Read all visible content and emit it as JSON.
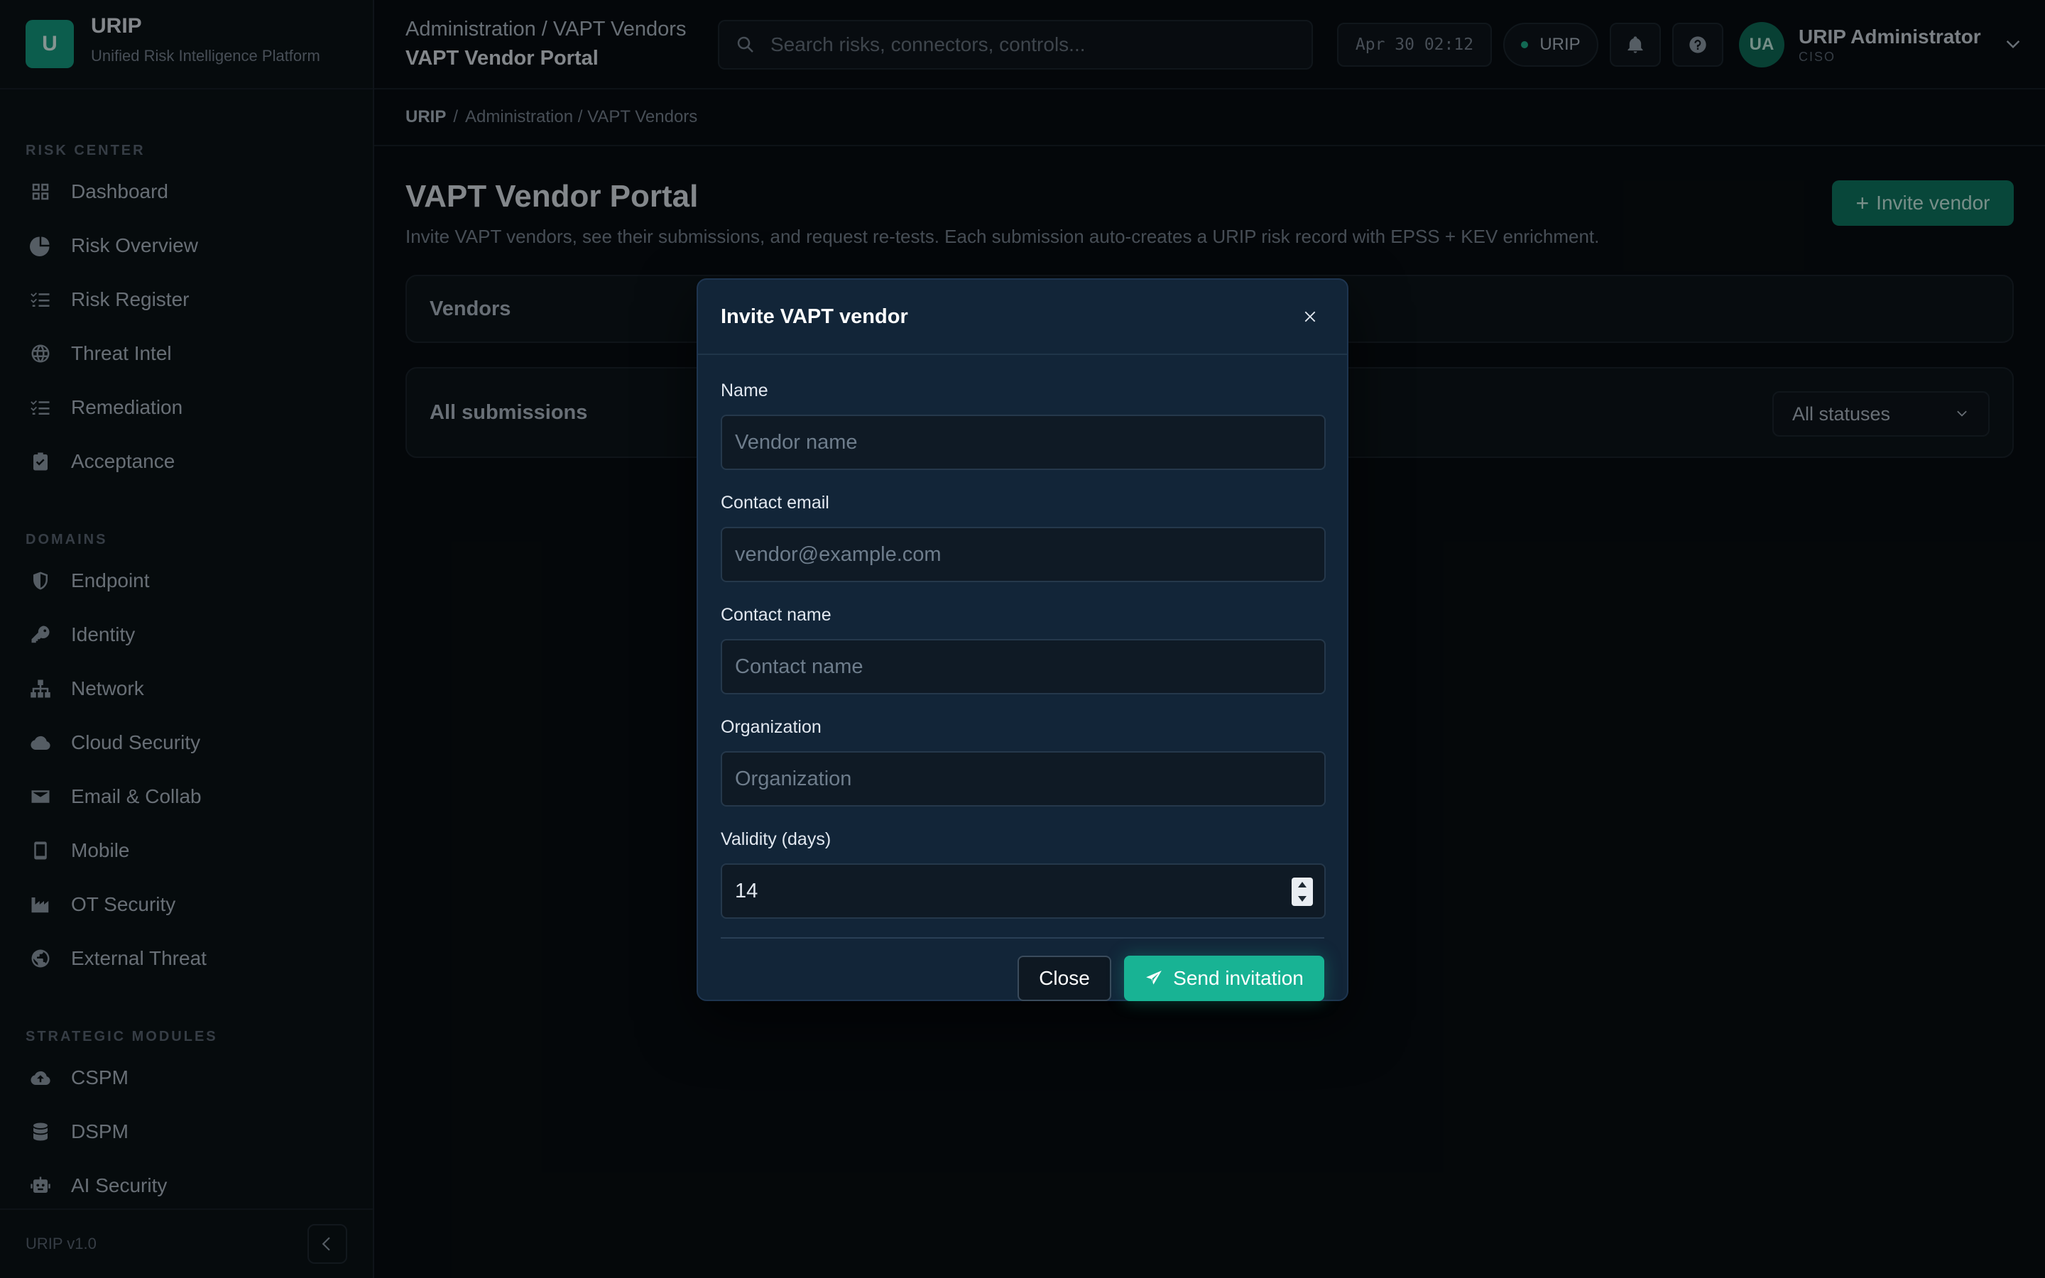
{
  "brand": {
    "logo_letter": "U",
    "name": "URIP",
    "subtitle": "Unified Risk Intelligence Platform"
  },
  "sidebar": {
    "sections": [
      {
        "title": "RISK CENTER",
        "items": [
          {
            "label": "Dashboard",
            "icon": "grid-icon"
          },
          {
            "label": "Risk Overview",
            "icon": "pie-chart-icon"
          },
          {
            "label": "Risk Register",
            "icon": "list-check-icon"
          },
          {
            "label": "Threat Intel",
            "icon": "globe-icon"
          },
          {
            "label": "Remediation",
            "icon": "list-check-icon"
          },
          {
            "label": "Acceptance",
            "icon": "clipboard-check-icon"
          }
        ]
      },
      {
        "title": "DOMAINS",
        "items": [
          {
            "label": "Endpoint",
            "icon": "shield-icon"
          },
          {
            "label": "Identity",
            "icon": "key-icon"
          },
          {
            "label": "Network",
            "icon": "network-icon"
          },
          {
            "label": "Cloud Security",
            "icon": "cloud-icon"
          },
          {
            "label": "Email & Collab",
            "icon": "envelope-icon"
          },
          {
            "label": "Mobile",
            "icon": "mobile-icon"
          },
          {
            "label": "OT Security",
            "icon": "factory-icon"
          },
          {
            "label": "External Threat",
            "icon": "globe-alt-icon"
          }
        ]
      },
      {
        "title": "STRATEGIC MODULES",
        "items": [
          {
            "label": "CSPM",
            "icon": "cloud-upload-icon"
          },
          {
            "label": "DSPM",
            "icon": "database-icon"
          },
          {
            "label": "AI Security",
            "icon": "robot-icon"
          }
        ]
      }
    ],
    "version": "URIP v1.0"
  },
  "topbar": {
    "crumb_top": "Administration / VAPT Vendors",
    "crumb_bottom": "VAPT Vendor Portal",
    "search_placeholder": "Search risks, connectors, controls...",
    "clock": "Apr 30 02:12",
    "tenant": "URIP",
    "user": {
      "initials": "UA",
      "name": "URIP Administrator",
      "role": "CISO"
    }
  },
  "breadcrumb": {
    "home": "URIP",
    "sep": "/",
    "rest": "Administration / VAPT Vendors"
  },
  "page": {
    "title": "VAPT Vendor Portal",
    "description": "Invite VAPT vendors, see their submissions, and request re-tests. Each submission auto-creates a URIP risk record with EPSS + KEV enrichment.",
    "invite_plus": "+",
    "invite_label": "Invite vendor",
    "vendors_card": "Vendors",
    "submissions_card": "All submissions",
    "status_filter": "All statuses"
  },
  "modal": {
    "title": "Invite VAPT vendor",
    "fields": {
      "name": {
        "label": "Name",
        "placeholder": "Vendor name",
        "value": ""
      },
      "email": {
        "label": "Contact email",
        "placeholder": "vendor@example.com",
        "value": ""
      },
      "contact": {
        "label": "Contact name",
        "placeholder": "Contact name",
        "value": ""
      },
      "org": {
        "label": "Organization",
        "placeholder": "Organization",
        "value": ""
      },
      "validity": {
        "label": "Validity (days)",
        "value": "14"
      }
    },
    "close_label": "Close",
    "send_label": "Send invitation"
  },
  "colors": {
    "accent": "#18b394",
    "background": "#080d12",
    "modal_bg": "#122538"
  }
}
